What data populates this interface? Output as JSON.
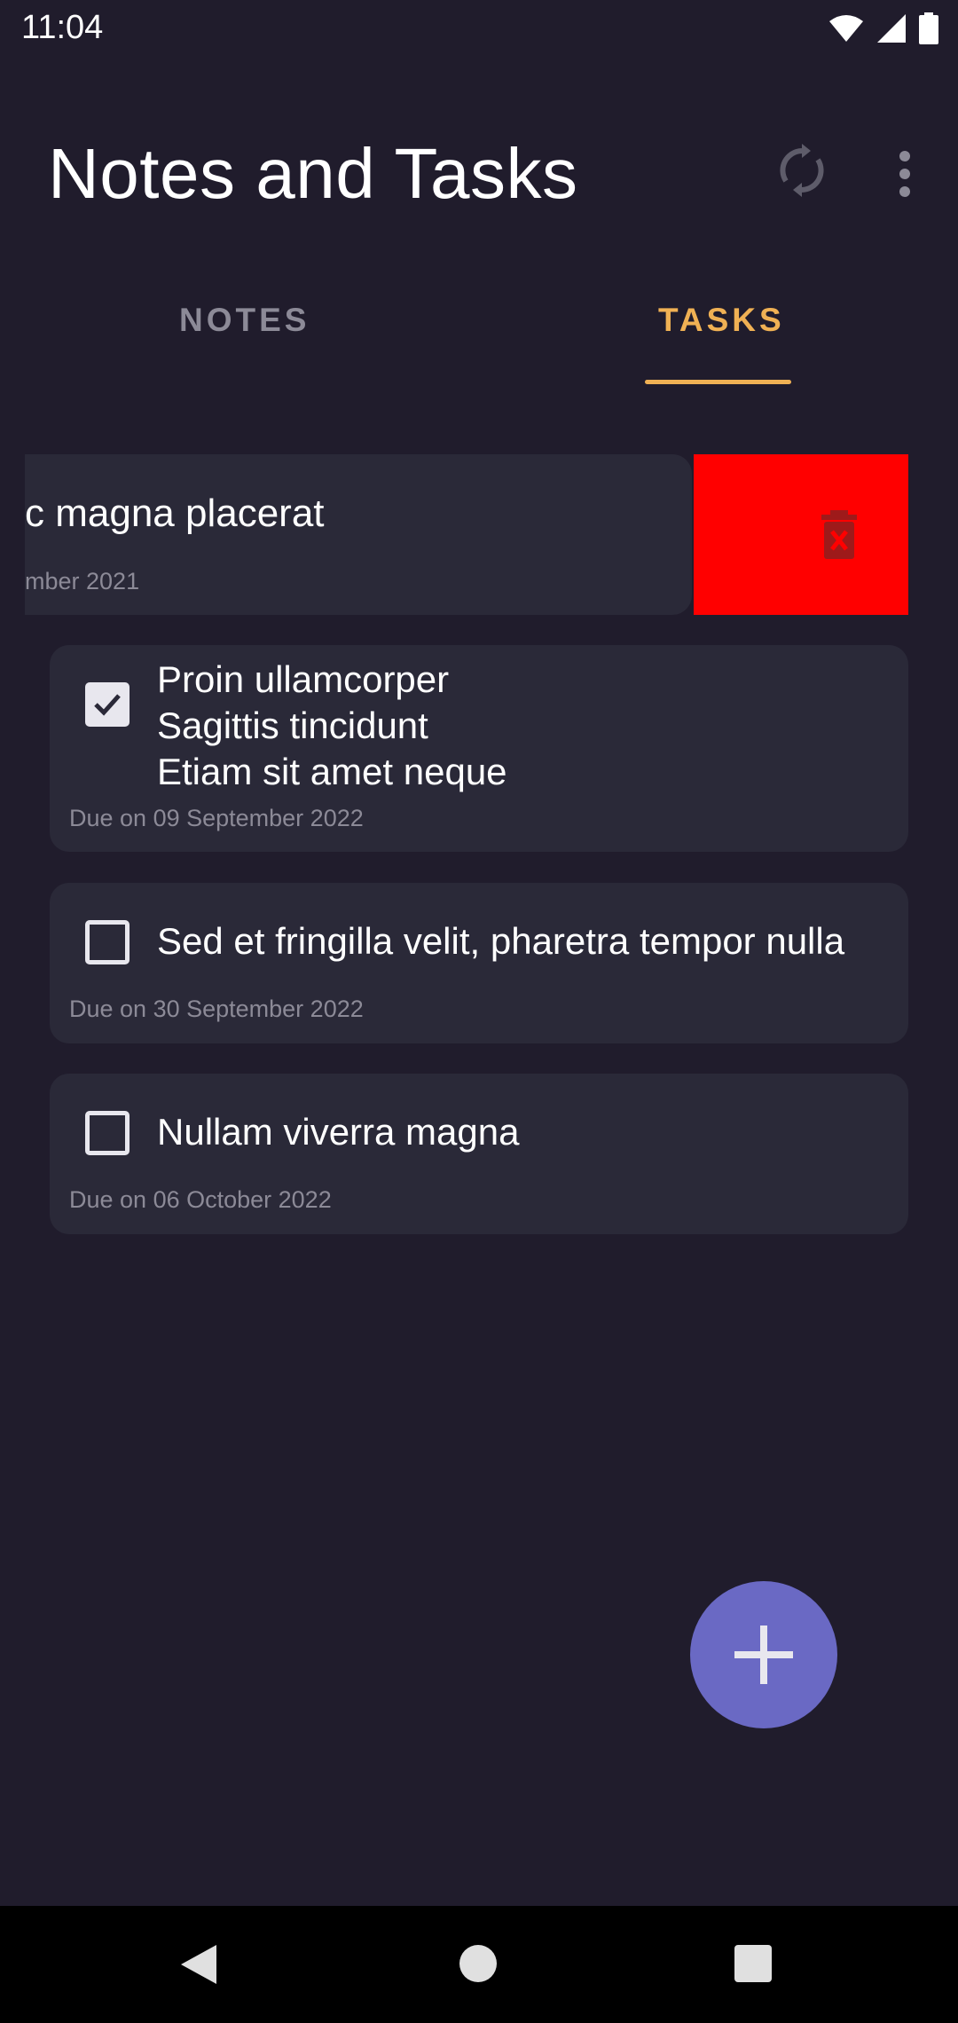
{
  "status_bar": {
    "time": "11:04"
  },
  "app_bar": {
    "title": "Notes and Tasks"
  },
  "tabs": [
    {
      "label": "NOTES",
      "selected": false
    },
    {
      "label": "TASKS",
      "selected": true
    }
  ],
  "swiped_item": {
    "title_visible": "c magna placerat",
    "date_visible": "mber 2021"
  },
  "tasks": [
    {
      "checked": true,
      "lines": [
        "Proin ullamcorper",
        "Sagittis tincidunt",
        "Etiam sit amet neque"
      ],
      "due": "Due on 09 September 2022"
    },
    {
      "checked": false,
      "lines": [
        "Sed et fringilla velit, pharetra tempor nulla"
      ],
      "due": "Due on 30 September 2022"
    },
    {
      "checked": false,
      "lines": [
        "Nullam viverra magna"
      ],
      "due": "Due on 06 October 2022"
    }
  ],
  "colors": {
    "background": "#201c2c",
    "card": "#2a2938",
    "accent": "#f0b154",
    "delete": "#ff0000",
    "fab": "#6a69c4"
  },
  "icons": {
    "sync": "sync-icon",
    "more": "more-vert-icon",
    "delete": "delete-icon",
    "add": "add-icon"
  }
}
